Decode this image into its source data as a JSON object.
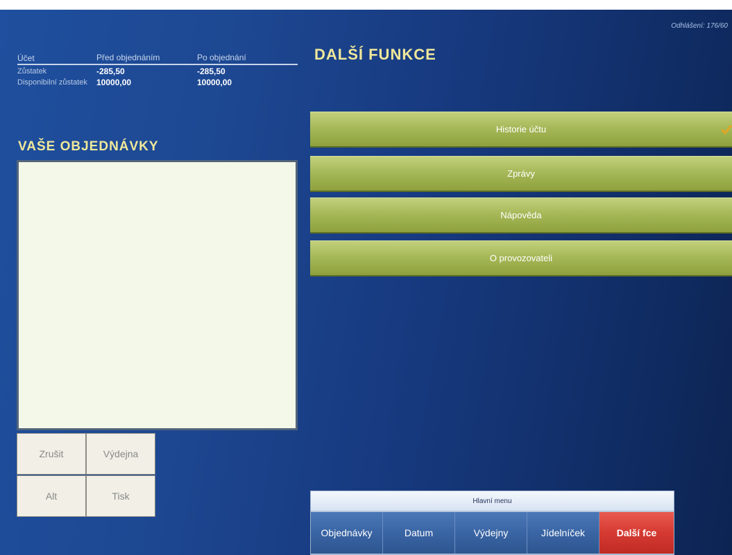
{
  "header": {
    "logout": "Odhlášení: 176/60"
  },
  "account": {
    "columns": [
      "Účet",
      "Před objednáním",
      "Po objednání"
    ],
    "rows": [
      {
        "label": "Zůstatek",
        "before": "-285,50",
        "after": "-285,50"
      },
      {
        "label": "Disponibilní zůstatek",
        "before": "10000,00",
        "after": "10000,00"
      }
    ]
  },
  "orders": {
    "title": "VAŠE OBJEDNÁVKY",
    "buttons": {
      "cancel": "Zrušit",
      "canteen": "Výdejna",
      "alt": "Alt",
      "print": "Tisk"
    }
  },
  "functions": {
    "title": "DALŠÍ FUNKCE",
    "items": [
      "Historie účtu",
      "Zprávy",
      "Nápověda",
      "O provozovateli"
    ]
  },
  "nav": {
    "title": "Hlavní menu",
    "tabs": [
      "Objednávky",
      "Datum",
      "Výdejny",
      "Jídelníček",
      "Další fce"
    ],
    "active": "Další fce"
  },
  "colors": {
    "accent_green": "#a6b959",
    "active_tab": "#d53a32",
    "title_yellow": "#f0e89a"
  }
}
